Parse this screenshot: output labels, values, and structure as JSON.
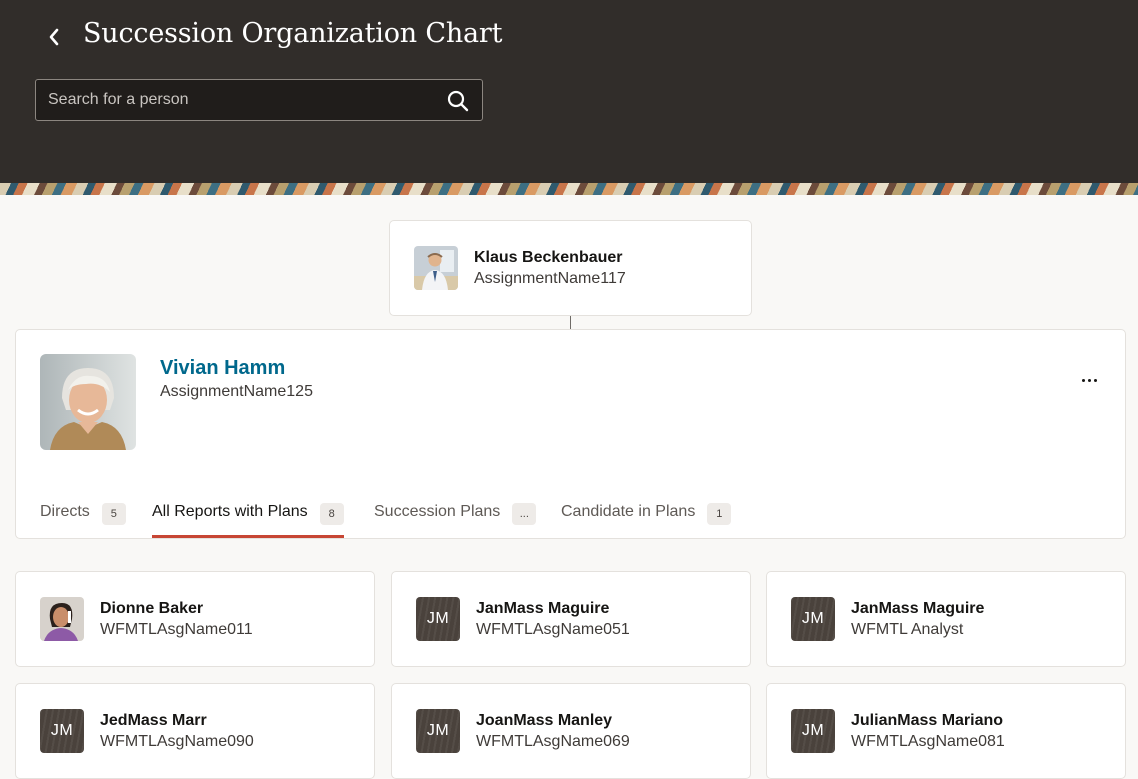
{
  "header": {
    "title": "Succession Organization Chart",
    "search_placeholder": "Search for a person"
  },
  "manager": {
    "name": "Klaus Beckenbauer",
    "assignment": "AssignmentName117"
  },
  "focus": {
    "name": "Vivian Hamm",
    "assignment": "AssignmentName125",
    "tabs": [
      {
        "label": "Directs",
        "badge": "5"
      },
      {
        "label": "All Reports with Plans",
        "badge": "8",
        "active": true
      },
      {
        "label": "Succession Plans",
        "badge": "..."
      },
      {
        "label": "Candidate in Plans",
        "badge": "1"
      }
    ]
  },
  "reports": [
    {
      "name": "Dionne Baker",
      "assignment": "WFMTLAsgName011",
      "photo": true
    },
    {
      "name": "JanMass Maguire",
      "assignment": "WFMTLAsgName051",
      "initials": "JM"
    },
    {
      "name": "JanMass Maguire",
      "assignment": "WFMTL Analyst",
      "initials": "JM"
    },
    {
      "name": "JedMass Marr",
      "assignment": "WFMTLAsgName090",
      "initials": "JM"
    },
    {
      "name": "JoanMass Manley",
      "assignment": "WFMTLAsgName069",
      "initials": "JM"
    },
    {
      "name": "JulianMass Mariano",
      "assignment": "WFMTLAsgName081",
      "initials": "JM"
    }
  ],
  "colors": {
    "header_bg": "#312d2a",
    "link": "#00688c",
    "tab_indicator": "#c74634"
  }
}
